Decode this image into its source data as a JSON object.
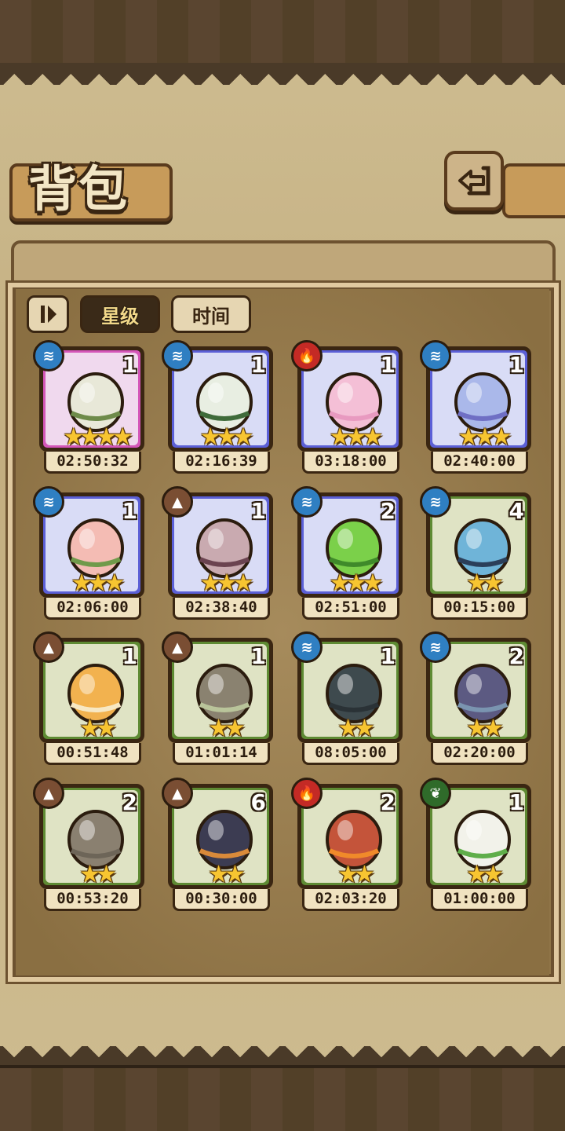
{
  "header": {
    "title": "背包"
  },
  "tabs": [
    {
      "label": "星级",
      "active": true
    },
    {
      "label": "时间",
      "active": false
    }
  ],
  "colors": {
    "water": "#2f7fc2",
    "fire": "#c42a25",
    "earth": "#7a4e33",
    "grass": "#2f6b2a"
  },
  "items": [
    {
      "element": "water",
      "element_icon": "water-icon",
      "count": "1",
      "stars": 4,
      "time": "02:50:32",
      "frame": "#d456b8",
      "fill": "#f0d9ee",
      "egg": "#e8e8d8",
      "egg2": "#6e8b4a"
    },
    {
      "element": "water",
      "element_icon": "water-icon",
      "count": "1",
      "stars": 3,
      "time": "02:16:39",
      "frame": "#5b5fd6",
      "fill": "#d9dcf6",
      "egg": "#e8eee2",
      "egg2": "#3f6b3a"
    },
    {
      "element": "fire",
      "element_icon": "fire-icon",
      "count": "1",
      "stars": 3,
      "time": "03:18:00",
      "frame": "#5b5fd6",
      "fill": "#d9dcf6",
      "egg": "#f4bfd6",
      "egg2": "#e89ac0"
    },
    {
      "element": "water",
      "element_icon": "water-icon",
      "count": "1",
      "stars": 3,
      "time": "02:40:00",
      "frame": "#5b5fd6",
      "fill": "#d9dcf6",
      "egg": "#aab8ea",
      "egg2": "#6f6fc4"
    },
    {
      "element": "water",
      "element_icon": "water-icon",
      "count": "1",
      "stars": 3,
      "time": "02:06:00",
      "frame": "#5b5fd6",
      "fill": "#d9dcf6",
      "egg": "#f4bcb4",
      "egg2": "#6f9a4a"
    },
    {
      "element": "earth",
      "element_icon": "earth-icon",
      "count": "1",
      "stars": 3,
      "time": "02:38:40",
      "frame": "#5b5fd6",
      "fill": "#d9dcf6",
      "egg": "#c9aab0",
      "egg2": "#6b4350"
    },
    {
      "element": "water",
      "element_icon": "water-icon",
      "count": "2",
      "stars": 3,
      "time": "02:51:00",
      "frame": "#5b5fd6",
      "fill": "#d9dcf6",
      "egg": "#7bd04a",
      "egg2": "#3f8a2a"
    },
    {
      "element": "water",
      "element_icon": "water-icon",
      "count": "4",
      "stars": 2,
      "time": "00:15:00",
      "frame": "#5e8a33",
      "fill": "#dfe3c4",
      "egg": "#6fb4d8",
      "egg2": "#2b3f5a"
    },
    {
      "element": "earth",
      "element_icon": "earth-icon",
      "count": "1",
      "stars": 2,
      "time": "00:51:48",
      "frame": "#5e8a33",
      "fill": "#dfe3c4",
      "egg": "#f2b24f",
      "egg2": "#f7e8c4"
    },
    {
      "element": "earth",
      "element_icon": "earth-icon",
      "count": "1",
      "stars": 2,
      "time": "01:01:14",
      "frame": "#5e8a33",
      "fill": "#dfe3c4",
      "egg": "#8a8270",
      "egg2": "#b9c49a"
    },
    {
      "element": "water",
      "element_icon": "water-icon",
      "count": "1",
      "stars": 2,
      "time": "08:05:00",
      "frame": "#5e8a33",
      "fill": "#dfe3c4",
      "egg": "#3e4a4e",
      "egg2": "#2a3236"
    },
    {
      "element": "water",
      "element_icon": "water-icon",
      "count": "2",
      "stars": 2,
      "time": "02:20:00",
      "frame": "#5e8a33",
      "fill": "#dfe3c4",
      "egg": "#5c5a82",
      "egg2": "#7a94b0"
    },
    {
      "element": "earth",
      "element_icon": "earth-icon",
      "count": "2",
      "stars": 2,
      "time": "00:53:20",
      "frame": "#5e8a33",
      "fill": "#dfe3c4",
      "egg": "#8a8070",
      "egg2": "#6d6558"
    },
    {
      "element": "earth",
      "element_icon": "earth-icon",
      "count": "6",
      "stars": 2,
      "time": "00:30:00",
      "frame": "#5e8a33",
      "fill": "#dfe3c4",
      "egg": "#3c3c52",
      "egg2": "#d98a3a"
    },
    {
      "element": "fire",
      "element_icon": "fire-icon",
      "count": "2",
      "stars": 2,
      "time": "02:03:20",
      "frame": "#5e8a33",
      "fill": "#dfe3c4",
      "egg": "#c4543a",
      "egg2": "#f08a2a"
    },
    {
      "element": "grass",
      "element_icon": "leaf-icon",
      "count": "1",
      "stars": 2,
      "time": "01:00:00",
      "frame": "#5e8a33",
      "fill": "#dfe3c4",
      "egg": "#f2f2ea",
      "egg2": "#5fae4a"
    }
  ]
}
